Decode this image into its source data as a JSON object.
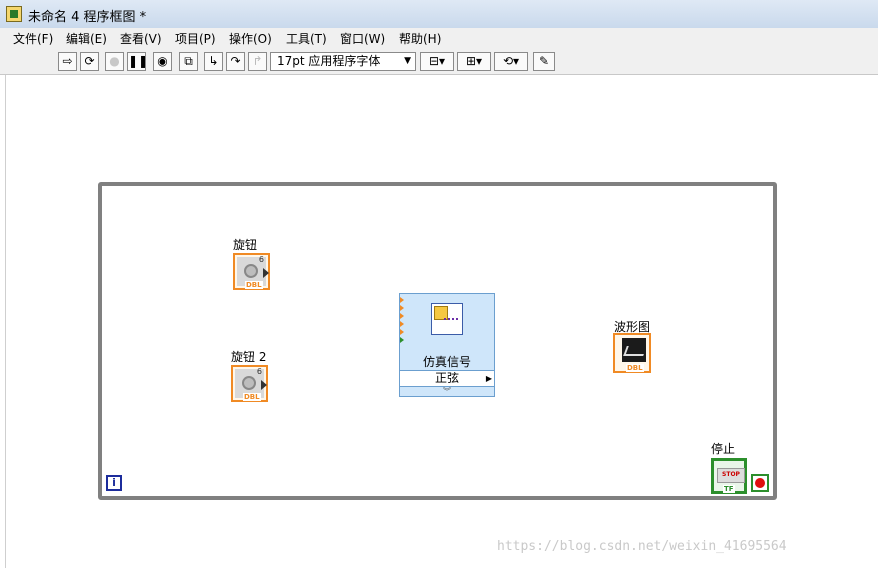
{
  "window": {
    "title": "未命名 4 程序框图 *"
  },
  "menu": [
    "文件(F)",
    "编辑(E)",
    "查看(V)",
    "项目(P)",
    "操作(O)",
    "工具(T)",
    "窗口(W)",
    "帮助(H)"
  ],
  "toolbar": {
    "font_label": "17pt 应用程序字体"
  },
  "diagram": {
    "knob1_label": "旋钮",
    "knob2_label": "旋钮 2",
    "knob_type": "DBL",
    "sim_name": "仿真信号",
    "sim_subtype": "正弦",
    "graph_label": "波形图",
    "graph_type": "DBL",
    "stop_label": "停止",
    "stop_face": "STOP",
    "stop_type": "TF",
    "iteration_label": "i"
  },
  "watermark": "https://blog.csdn.net/weixin_41695564"
}
